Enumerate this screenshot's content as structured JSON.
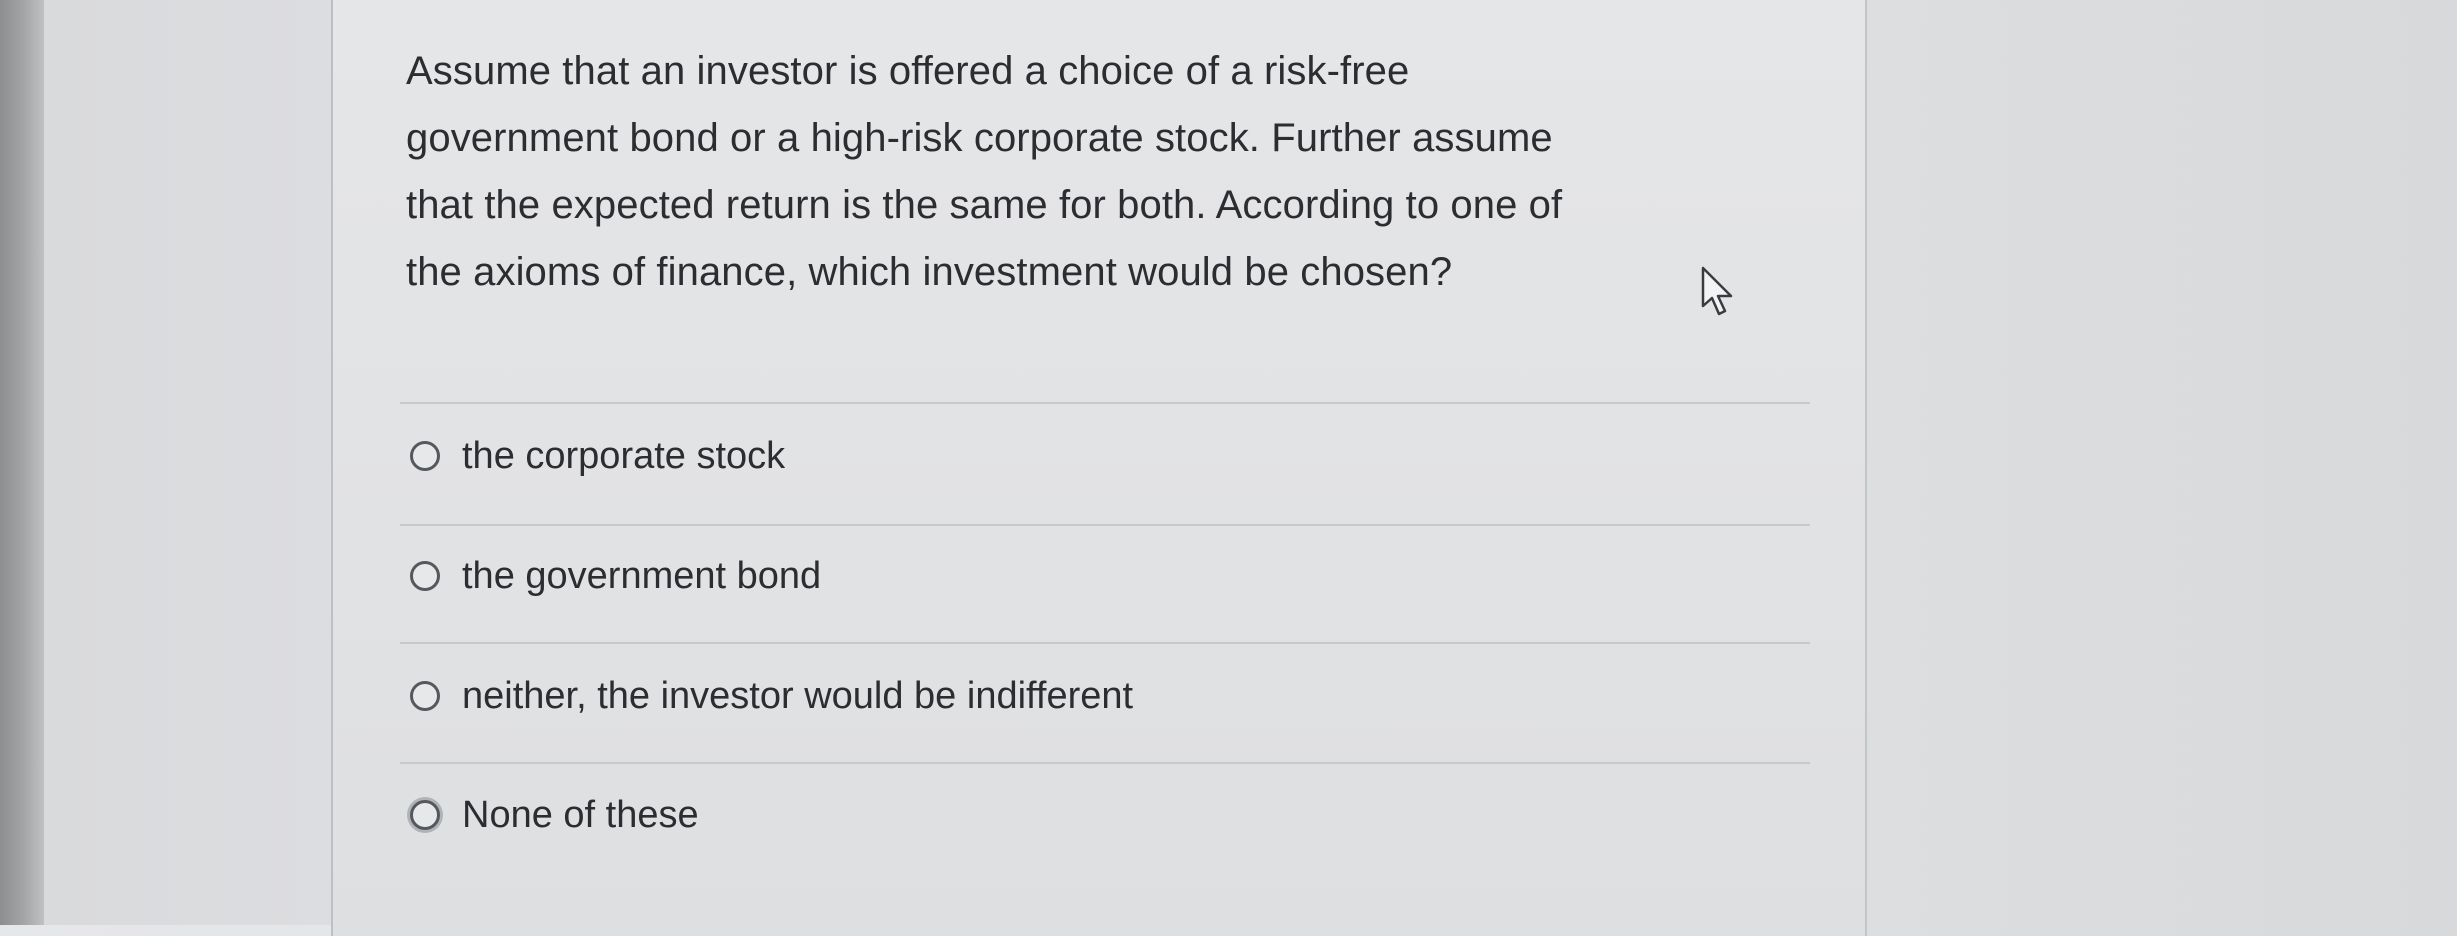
{
  "question": {
    "line1": "Assume that an investor is offered a choice of a risk-free",
    "line2": "government bond or a high-risk corporate stock. Further assume",
    "line3": "that the expected return is the same for both. According to one of",
    "line4": "the axioms of finance, which investment would be chosen?"
  },
  "options": [
    {
      "label": "the corporate stock"
    },
    {
      "label": "the government bond"
    },
    {
      "label": "neither, the investor would be indifferent"
    },
    {
      "label": "None of these"
    }
  ],
  "icons": {
    "cursor": "mouse-pointer-icon",
    "radio": "radio-button-icon"
  },
  "colors": {
    "text": "#2b2d30",
    "background": "#e2e3e5",
    "divider": "#c7c9cc"
  }
}
